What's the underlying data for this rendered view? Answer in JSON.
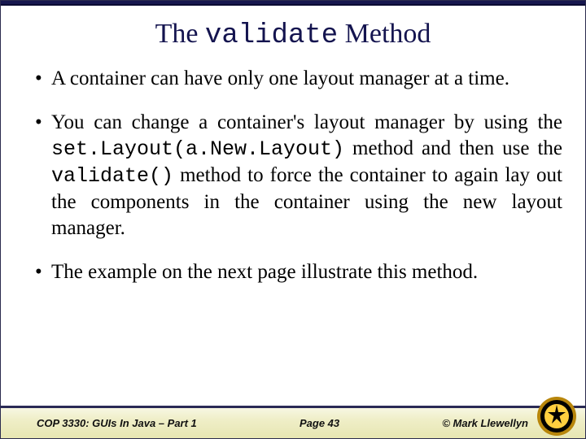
{
  "title": {
    "prefix": "The ",
    "code": "validate",
    "suffix": " Method"
  },
  "bullets": {
    "b1": "A container can have only one layout manager at a time.",
    "b2": {
      "p1": "You can change a container's layout manager by using the ",
      "code1": "set.Layout(a.New.Layout)",
      "p2": " method and then use the ",
      "code2": "validate()",
      "p3": " method to force the container to again lay out the components in the container using the new layout manager."
    },
    "b3": "The example on the next page illustrate this method."
  },
  "footer": {
    "course": "COP 3330: GUIs In Java – Part 1",
    "page": "Page 43",
    "author": "© Mark Llewellyn"
  }
}
